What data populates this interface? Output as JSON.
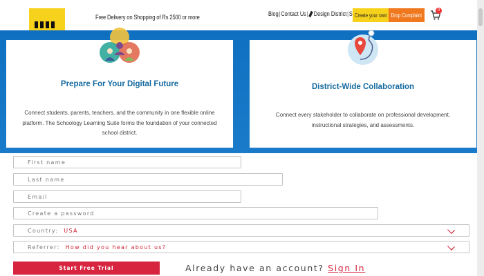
{
  "header": {
    "promo": "Free Delivery on Shopping of Rs 2500 or more",
    "nav": {
      "blog": "Blog",
      "contact": "Contact Us",
      "design": "Design District",
      "signup": "Signup"
    },
    "create_button": "Create your own",
    "complaint_button": "Drop Complaint",
    "cart_count": "0",
    "logo_color": "#f7d21c",
    "complaint_color": "#f0781e"
  },
  "cards": [
    {
      "title": "Prepare For Your Digital Future",
      "description": "Connect students, parents, teachers, and the community in one flexible online platform. The Schoology Learning Suite forms the foundation of your connected school district.",
      "icon": "people-group-icon"
    },
    {
      "title": "District-Wide Collaboration",
      "description": "Connect every stakeholder to collaborate on professional development, instructional strategies, and assessments.",
      "icon": "map-pin-route-icon"
    }
  ],
  "form": {
    "first_name_placeholder": "First name",
    "last_name_placeholder": "Last name",
    "email_placeholder": "Email",
    "password_placeholder": "Create a password",
    "country_label": "Country:",
    "country_value": "USA",
    "referrer_label": "Referrer:",
    "referrer_value": "How did you hear about us?",
    "submit_label": "Start Free Trial",
    "account_prompt": "Already have an account?",
    "signin_label": "Sign In"
  },
  "colors": {
    "band_blue": "#1a7bcb",
    "title_blue": "#13699f",
    "accent_red": "#d7253f"
  }
}
